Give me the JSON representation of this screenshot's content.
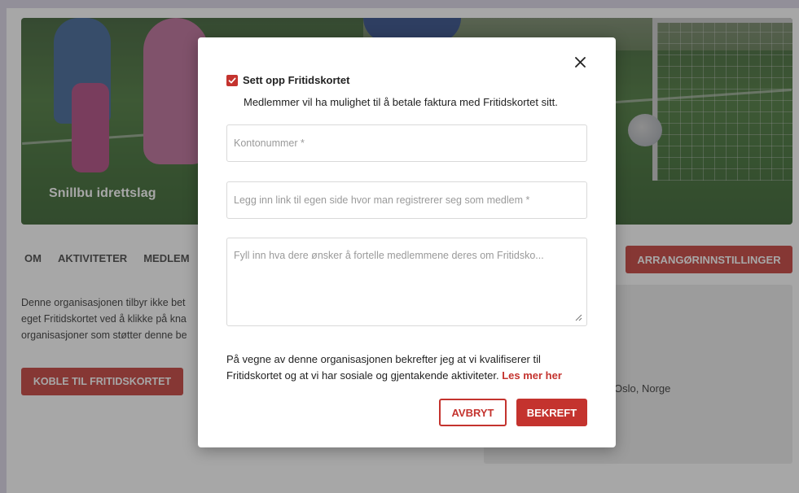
{
  "organization": {
    "name": "Snillbu idrettslag",
    "description": "Denne organisasjonen tilbyr ikke bet\neget Fritidskortet ved å klikke på kna\norganisasjoner som støtter denne be",
    "connect_button": "KOBLE TIL FRITIDSKORTET",
    "settings_button": "ARRANGØRINNSTILLINGER",
    "address": "Oslo, Norge"
  },
  "nav": {
    "items": [
      {
        "label": "OM"
      },
      {
        "label": "AKTIVITETER"
      },
      {
        "label": "MEDLEM"
      }
    ]
  },
  "modal": {
    "checkbox_label": "Sett opp Fritidskortet",
    "checkbox_checked": true,
    "subtext": "Medlemmer vil ha mulighet til å betale faktura med Fritidskortet sitt.",
    "fields": {
      "account_placeholder": "Kontonummer *",
      "link_placeholder": "Legg inn link til egen side hvor man registrerer seg som medlem *",
      "info_placeholder": "Fyll inn hva dere ønsker å fortelle medlemmene deres om Fritidsko..."
    },
    "confirm_text": "På vegne av denne organisasjonen bekrefter jeg at vi kvalifiserer til Fritidskortet og at vi har sosiale og gjentakende aktiviteter.",
    "read_more": "Les mer her",
    "cancel_button": "AVBRYT",
    "confirm_button": "BEKREFT"
  },
  "colors": {
    "accent": "#c4332e",
    "overlay": "#3c3c3c"
  }
}
